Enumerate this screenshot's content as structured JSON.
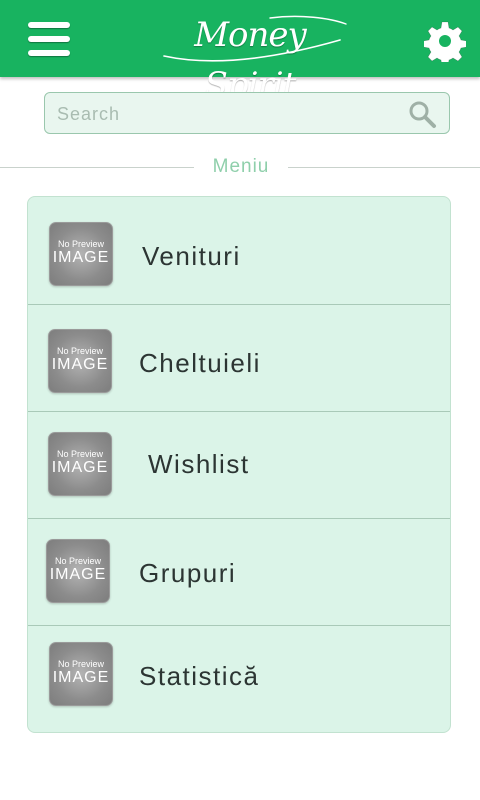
{
  "header": {
    "logo_text": "Money Spirit",
    "menu_icon": "hamburger-menu-icon",
    "settings_icon": "gear-icon",
    "bar_color": "#18b360"
  },
  "search": {
    "placeholder": "Search",
    "value": "",
    "icon": "search-icon"
  },
  "section": {
    "title": "Meniu"
  },
  "menu": {
    "items": [
      {
        "label": "Venituri",
        "thumb_line1": "No Preview",
        "thumb_line2": "IMAGE"
      },
      {
        "label": "Cheltuieli",
        "thumb_line1": "No Preview",
        "thumb_line2": "IMAGE"
      },
      {
        "label": "Wishlist",
        "thumb_line1": "No Preview",
        "thumb_line2": "IMAGE"
      },
      {
        "label": "Grupuri",
        "thumb_line1": "No Preview",
        "thumb_line2": "IMAGE"
      },
      {
        "label": "Statistică",
        "thumb_line1": "No Preview",
        "thumb_line2": "IMAGE"
      }
    ]
  },
  "colors": {
    "accent": "#18b360",
    "card_background": "#dbf4e8",
    "section_title": "#8fcfab"
  }
}
